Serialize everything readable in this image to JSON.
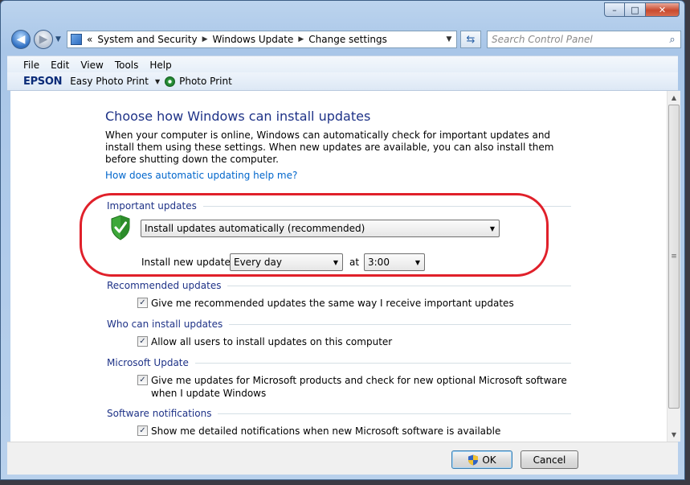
{
  "window": {
    "caption_buttons": {
      "minimize": "–",
      "maximize": "□",
      "close": "✕"
    }
  },
  "nav": {
    "back_glyph": "◀",
    "forward_glyph": "▶",
    "dropdown_glyph": "▼",
    "address_prefix": "«",
    "breadcrumbs": [
      "System and Security",
      "Windows Update",
      "Change settings"
    ],
    "separator": "▶",
    "address_drop": "▼",
    "refresh_glyph": "⇆",
    "search_placeholder": "Search Control Panel",
    "search_glyph": "⌕"
  },
  "menubar": {
    "items": [
      "File",
      "Edit",
      "View",
      "Tools",
      "Help"
    ]
  },
  "toolbar": {
    "brand": "EPSON",
    "easy_photo_print": "Easy Photo Print",
    "drop_glyph": "▼",
    "photo_print": "Photo Print"
  },
  "main": {
    "title": "Choose how Windows can install updates",
    "description": "When your computer is online, Windows can automatically check for important updates and install them using these settings. When new updates are available, you can also install them before shutting down the computer.",
    "help_link": "How does automatic updating help me?",
    "important": {
      "heading": "Important updates",
      "mode_select": "Install updates automatically (recommended)",
      "install_label": "Install new updates:",
      "day_select": "Every day",
      "at_label": "at",
      "time_select": "3:00",
      "select_arrow": "▼"
    },
    "recommended": {
      "heading": "Recommended updates",
      "checkbox_label": "Give me recommended updates the same way I receive important updates",
      "checked": true
    },
    "who": {
      "heading": "Who can install updates",
      "checkbox_label": "Allow all users to install updates on this computer",
      "checked": true
    },
    "microsoft": {
      "heading": "Microsoft Update",
      "checkbox_label": "Give me updates for Microsoft products and check for new optional Microsoft software when I update Windows",
      "checked": true
    },
    "notifications": {
      "heading": "Software notifications",
      "checkbox_label": "Show me detailed notifications when new Microsoft software is available",
      "checked": true
    },
    "check_glyph": "✓"
  },
  "scrollbar": {
    "up": "▲",
    "down": "▼",
    "grip": "≡"
  },
  "footer": {
    "ok_label": "OK",
    "cancel_label": "Cancel"
  },
  "colors": {
    "annotation_oval": "#e0202a",
    "heading_blue": "#1e3287",
    "link_blue": "#0066cc"
  }
}
